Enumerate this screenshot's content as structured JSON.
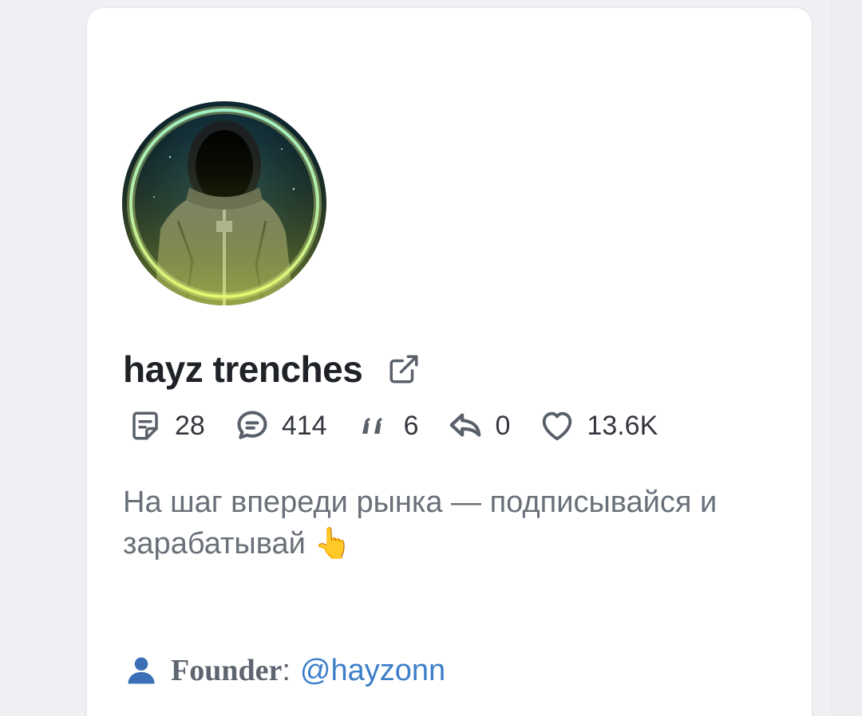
{
  "channel": {
    "name": "hayz trenches",
    "bio_line1": "На шаг впереди рынка — подписывайся и",
    "bio_line2": "зарабатывай",
    "bio_emoji": "👆"
  },
  "stats": {
    "posts": "28",
    "comments": "414",
    "quotes": "6",
    "reposts": "0",
    "likes": "13.6K"
  },
  "founder": {
    "label": "Founder",
    "separator": ":",
    "handle": "@hayzonn"
  },
  "icons": {
    "external": "external-link-icon",
    "posts": "note-icon",
    "comments": "chat-bubble-icon",
    "quotes": "quote-icon",
    "reposts": "reply-arrow-icon",
    "likes": "heart-icon",
    "founder": "person-icon"
  },
  "colors": {
    "name": "#1f2226",
    "text_muted": "#6a7079",
    "icon": "#5a606a",
    "link": "#3d7fc8",
    "founder_icon": "#3b6fb6"
  }
}
